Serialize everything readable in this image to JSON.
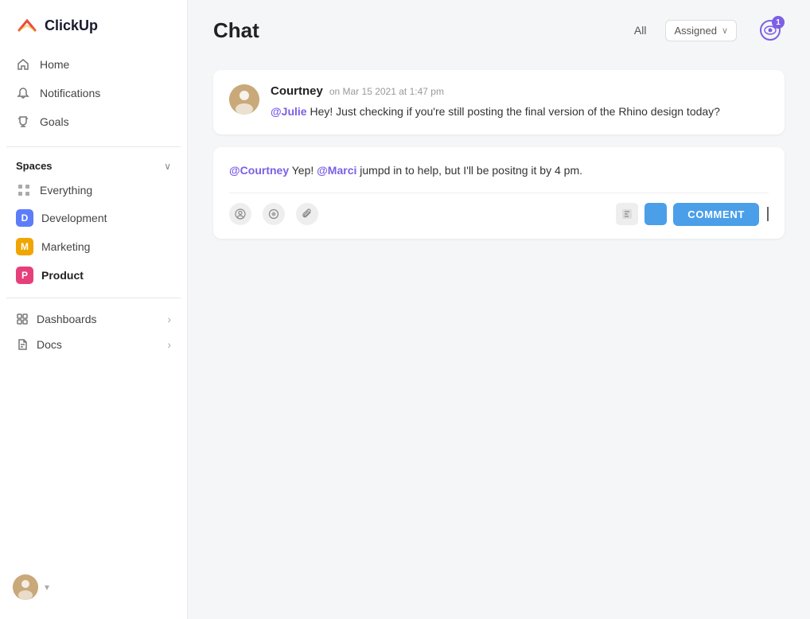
{
  "sidebar": {
    "logo_text": "ClickUp",
    "nav": [
      {
        "id": "home",
        "label": "Home",
        "icon": "🏠"
      },
      {
        "id": "notifications",
        "label": "Notifications",
        "icon": "🔔"
      },
      {
        "id": "goals",
        "label": "Goals",
        "icon": "🏆"
      }
    ],
    "spaces_label": "Spaces",
    "space_items": [
      {
        "id": "everything",
        "label": "Everything",
        "type": "grid"
      },
      {
        "id": "development",
        "label": "Development",
        "badge": "D",
        "color": "#5c7cfa"
      },
      {
        "id": "marketing",
        "label": "Marketing",
        "badge": "M",
        "color": "#f0a500"
      },
      {
        "id": "product",
        "label": "Product",
        "badge": "P",
        "color": "#e6407a",
        "active": true
      }
    ],
    "sections": [
      {
        "id": "dashboards",
        "label": "Dashboards"
      },
      {
        "id": "docs",
        "label": "Docs"
      }
    ],
    "user_chevron": "▾"
  },
  "header": {
    "title": "Chat",
    "filter_all": "All",
    "filter_assigned": "Assigned",
    "notification_count": "1"
  },
  "messages": [
    {
      "id": "msg1",
      "author": "Courtney",
      "time": "on Mar 15 2021 at 1:47 pm",
      "mention": "@Julie",
      "text": " Hey! Just checking if you're still posting the final version of the Rhino design today?"
    }
  ],
  "reply": {
    "mention1": "@Courtney",
    "text1": " Yep! ",
    "mention2": "@Marci",
    "text2": " jumpd in to help, but I'll be positng it by 4 pm.",
    "comment_label": "COMMENT"
  },
  "icons": {
    "home": "⌂",
    "notification": "🔔",
    "goals": "⚑",
    "chevron_down": "∨",
    "chevron_right": "›",
    "eye": "👁",
    "user": "👤",
    "circle": "●",
    "paperclip": "📎"
  }
}
